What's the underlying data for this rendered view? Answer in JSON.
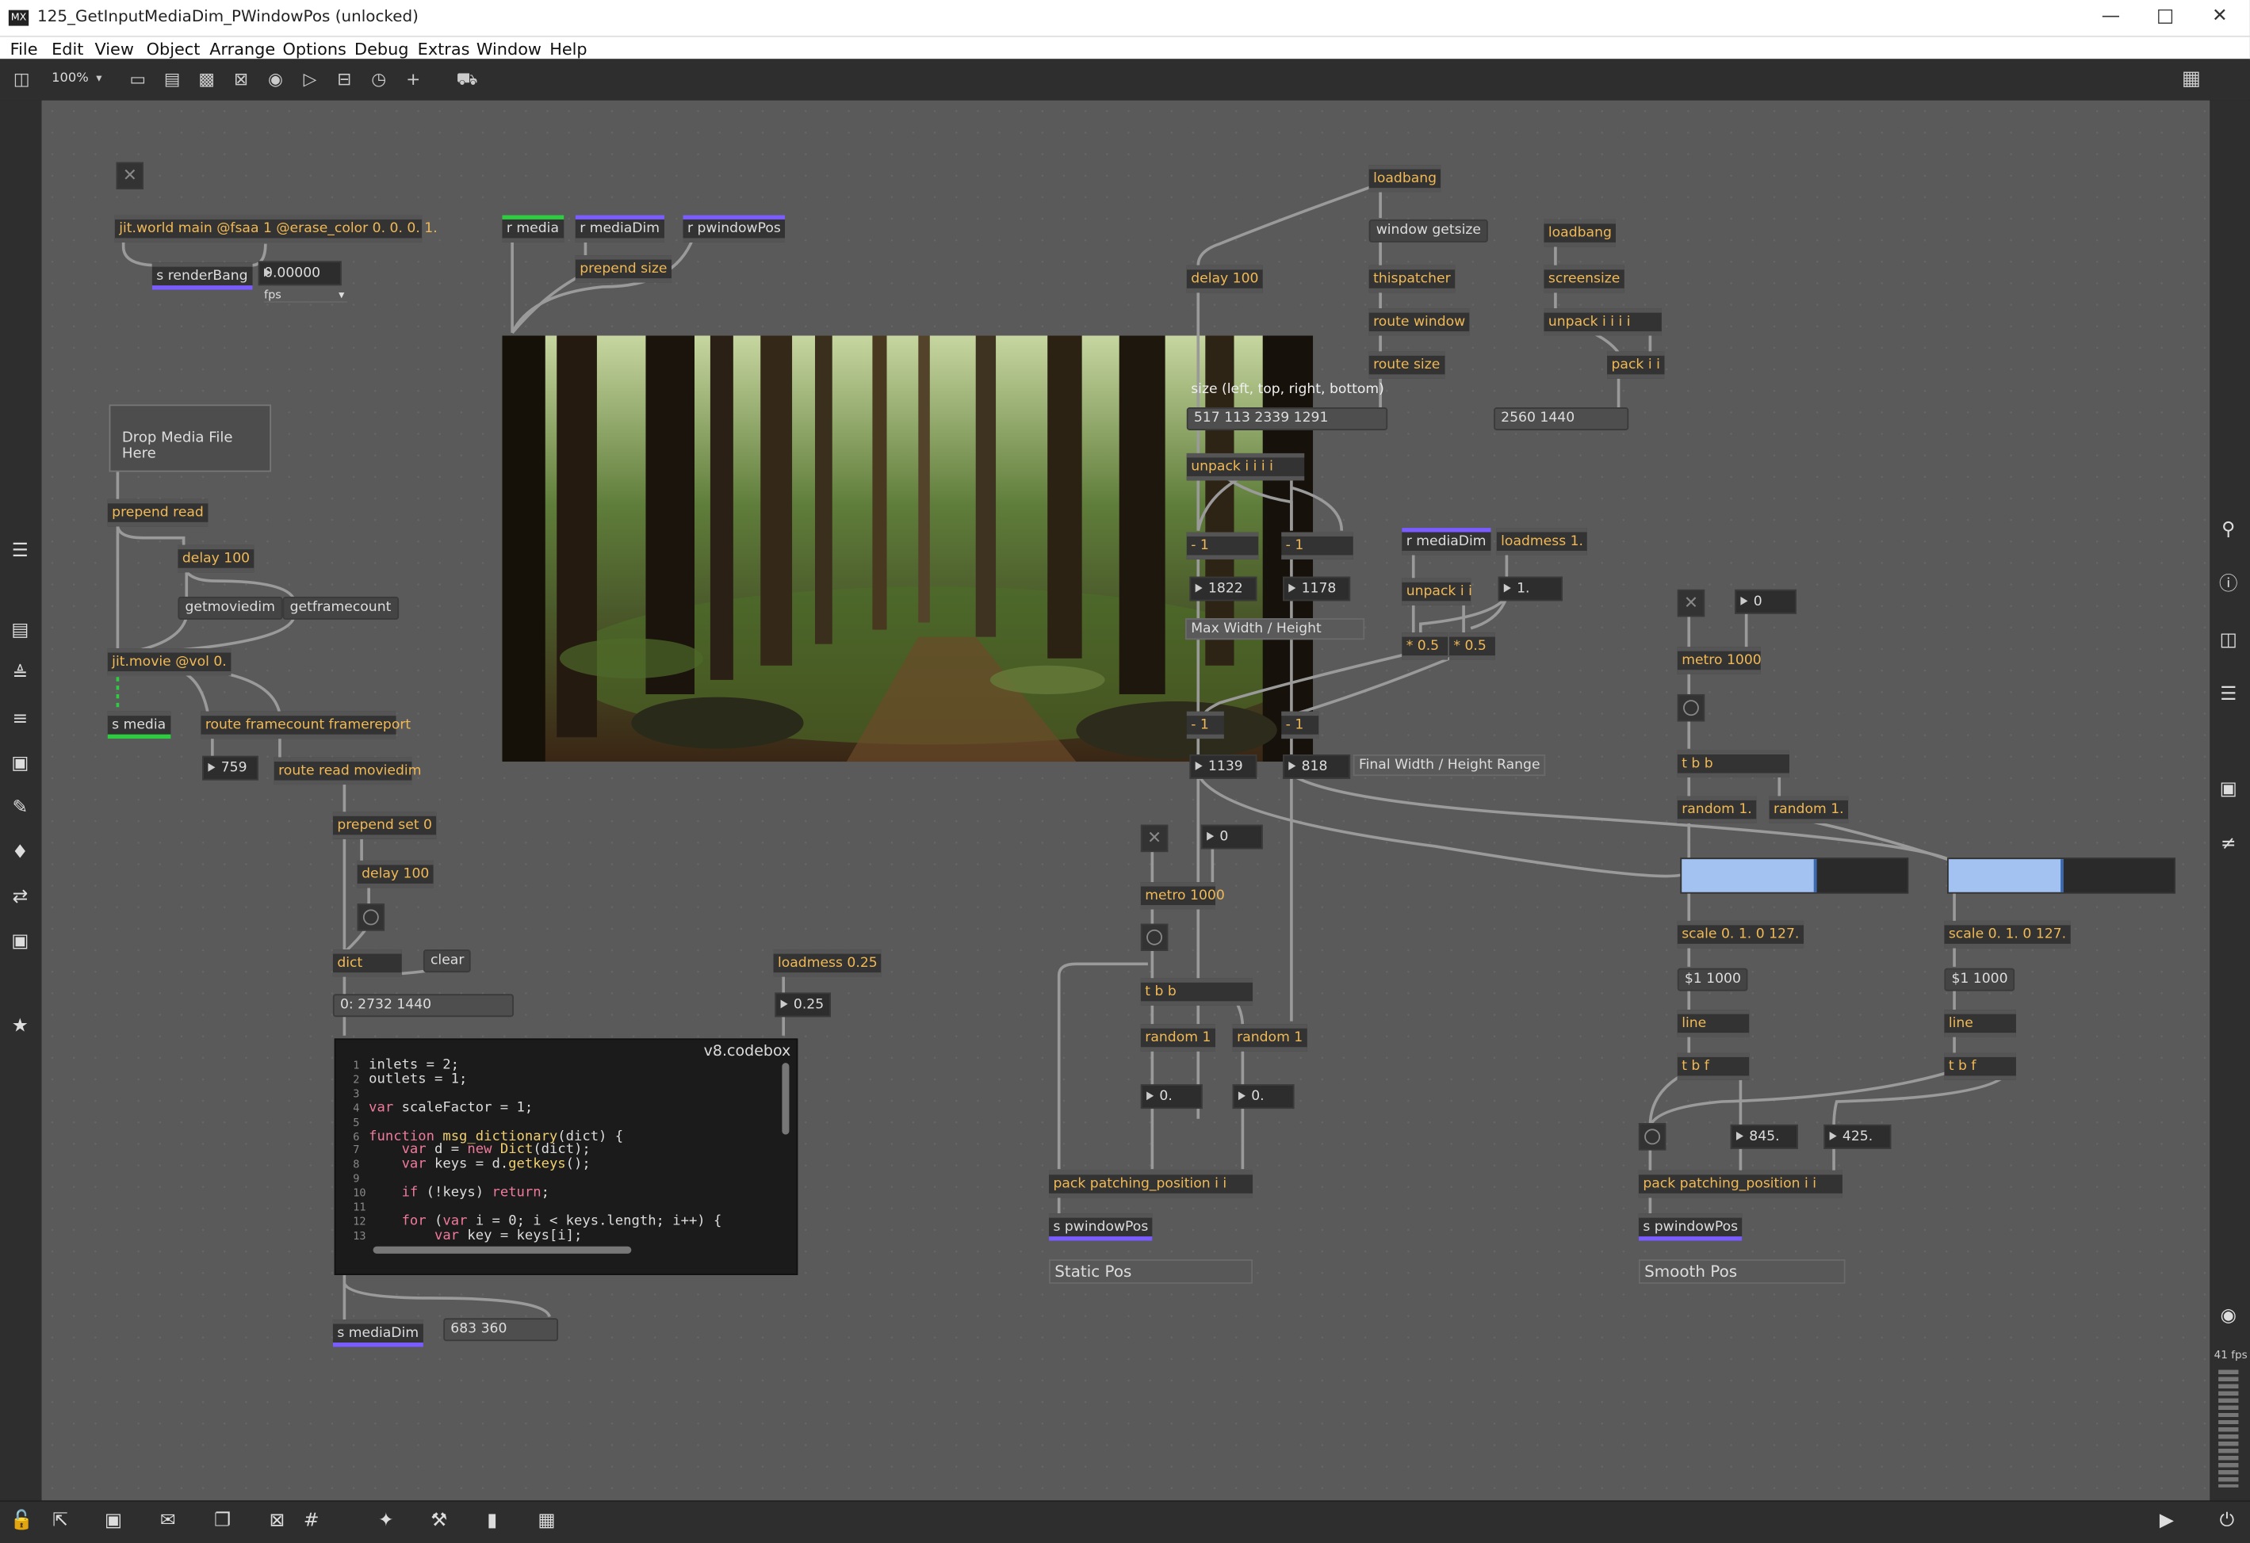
{
  "window": {
    "title": "125_GetInputMediaDim_PWindowPos (unlocked)",
    "logo": "MX"
  },
  "menu": [
    "File",
    "Edit",
    "View",
    "Object",
    "Arrange",
    "Options",
    "Debug",
    "Extras",
    "Window",
    "Help"
  ],
  "toolbar": {
    "zoom": "100%"
  },
  "status": {
    "fps": "41 fps"
  },
  "objects": {
    "jitworld": "jit.world main @fsaa 1 @erase_color 0. 0. 0. 1.",
    "renderbang": "s renderBang",
    "fpsnum": "0.00000",
    "fpsmenu": "fps",
    "rmedia": "r media",
    "rmediadim": "r mediaDim",
    "rpwindow": "r pwindowPos",
    "prependsize": "prepend size",
    "drop": "Drop Media File Here",
    "prependread": "prepend read",
    "delay100a": "delay 100",
    "getmoviedim": "getmoviedim",
    "getframecount": "getframecount",
    "jitmovie": "jit.movie @vol 0.",
    "smedia": "s media",
    "routeframe": "route framecount framereport",
    "n759": "759",
    "routeread": "route read moviedim",
    "prependset": "prepend set 0",
    "delay100b": "delay 100",
    "dict": "dict",
    "clear": "clear",
    "dictout": "0: 2732 1440",
    "loadmess025": "loadmess 0.25",
    "n025": "0.25",
    "codebox": "v8.codebox",
    "smediadim": "s mediaDim",
    "msg683": "683 360",
    "loadbang1": "loadbang",
    "windowgetsize": "window getsize",
    "thispatcher": "thispatcher",
    "routewindow": "route window",
    "routesize": "route size",
    "delay100c": "delay 100",
    "sizecomment": "size (left, top, right, bottom)",
    "sizemsg": "517 113 2339 1291",
    "unpack4": "unpack i i i i",
    "minus1a": "- 1",
    "minus1b": "- 1",
    "n1822": "1822",
    "n1178": "1178",
    "maxwh": "Max Width / Height",
    "rmediadim2": "r mediaDim",
    "loadmess1": "loadmess 1.",
    "unpack2": "unpack i i",
    "n1": "1.",
    "mult05a": "* 0.5",
    "mult05b": "* 0.5",
    "minus1c": "- 1",
    "minus1d": "- 1",
    "n1139": "1139",
    "n818": "818",
    "finalwh": "Final Width / Height Range",
    "loadbang2": "loadbang",
    "screensize": "screensize",
    "unpack4b": "unpack i i i i",
    "packii": "pack i i",
    "msg2560": "2560 1440",
    "n0a": "0",
    "metro1000a": "metro 1000",
    "tbb1": "t b b",
    "random1a": "random 1",
    "random1b": "random 1",
    "n0dot1": "0.",
    "n0dot2": "0.",
    "packpp1": "pack patching_position i i",
    "spwin1": "s pwindowPos",
    "staticpos": "Static Pos",
    "n0b": "0",
    "metro1000b": "metro 1000",
    "tbb2": "t b b",
    "random1c": "random 1.",
    "random1d": "random 1.",
    "scale1": "scale 0. 1. 0 127.",
    "scale2": "scale 0. 1. 0 127.",
    "m1000a": "$1 1000",
    "m1000b": "$1 1000",
    "line1": "line",
    "line2": "line",
    "tbf1": "t b f",
    "tbf2": "t b f",
    "n845": "845.",
    "n425": "425.",
    "packpp2": "pack patching_position i i",
    "spwin2": "s pwindowPos",
    "smoothpos": "Smooth Pos"
  },
  "sliders": {
    "slider1": 0.6,
    "slider2": 0.51
  },
  "code": [
    "inlets = 2;",
    "outlets = 1;",
    "",
    "var scaleFactor = 1;",
    "",
    "function msg_dictionary(dict) {",
    "    var d = new Dict(dict);",
    "    var keys = d.getkeys();",
    "",
    "    if (!keys) return;",
    "",
    "    for (var i = 0; i < keys.length; i++) {",
    "        var key = keys[i];"
  ],
  "code_lines": [
    "1",
    "2",
    "3",
    "4",
    "5",
    "6",
    "7",
    "8",
    "9",
    "10",
    "11",
    "12",
    "13"
  ],
  "colors": {
    "canvas": "#5a5a5a",
    "send": "#7a5cff",
    "receive": "#2ecc40",
    "slider": "#a3c2f2"
  }
}
